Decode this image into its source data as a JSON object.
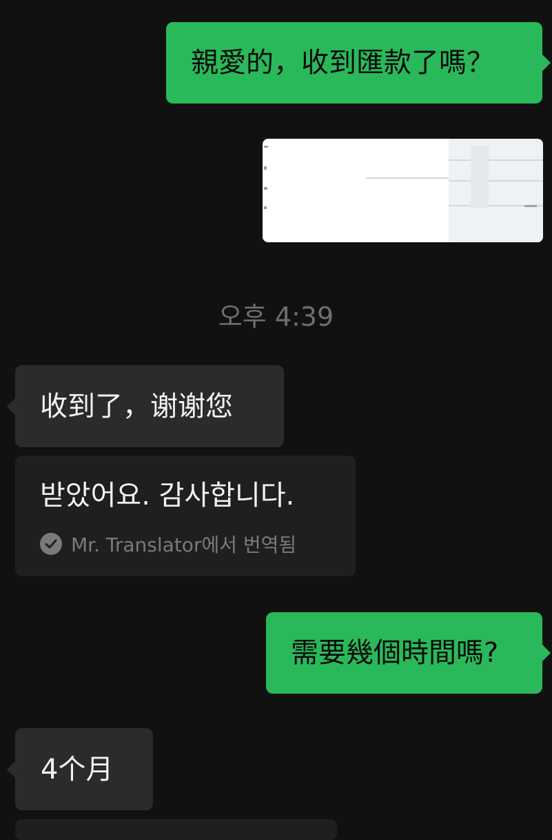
{
  "messages": {
    "out1": "親愛的，收到匯款了嗎？",
    "timestamp": "오후 4:39",
    "in1": "收到了，谢谢您",
    "translation": {
      "text": "받았어요. 감사합니다.",
      "footer": "Mr. Translator에서 번역됨",
      "icon": "check-circle-icon"
    },
    "out2": "需要幾個時間嗎?",
    "in2": "4个月"
  },
  "colors": {
    "background": "#111111",
    "outgoing_bubble": "#2ab95a",
    "incoming_bubble": "#2b2b2b",
    "translation_card": "#1f1f1f",
    "timestamp_text": "#6e6e6e"
  }
}
